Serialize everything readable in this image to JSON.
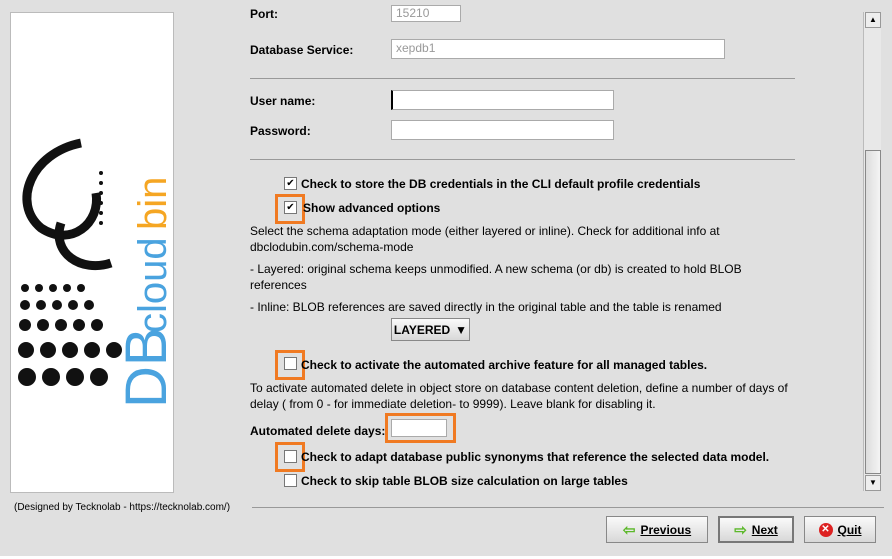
{
  "form": {
    "port_label": "Port:",
    "port_value": "15210",
    "service_label": "Database Service:",
    "service_value": "xepdb1",
    "user_label": "User name:",
    "user_value": "",
    "password_label": "Password:",
    "password_value": "",
    "store_creds_label": "Check to store the DB credentials in the CLI default profile credentials",
    "store_creds_checked": true,
    "advanced_label": "Show advanced options",
    "advanced_checked": true,
    "schema_info_1": "Select the schema adaptation mode (either layered or inline). Check for additional info at",
    "schema_info_2": "dbclodubin.com/schema-mode",
    "layered_info": " - Layered: original schema keeps unmodified. A new schema (or db) is created to hold BLOB references",
    "inline_info": " - Inline: BLOB references are saved directly in the original table and the table is renamed",
    "mode_value": "LAYERED",
    "archive_label": "Check to activate the automated archive feature for all managed tables.",
    "archive_checked": false,
    "delete_info": "To activate automated delete in object store on database content deletion, define a number of days of delay ( from 0 - for immediate deletion- to 9999). Leave blank for disabling it.",
    "delete_days_label": "Automated delete days:",
    "delete_days_value": "",
    "synonyms_label": "Check to adapt database public synonyms that reference the selected data model.",
    "synonyms_checked": false,
    "skip_blob_label": "Check to skip table BLOB size calculation on large tables",
    "skip_blob_checked": false
  },
  "logo": {
    "text_db": "DB",
    "text_cloud": "cloud",
    "text_bin": "bin"
  },
  "footer": {
    "credit": "(Designed by Tecknolab - https://tecknolab.com/)",
    "previous": "Previous",
    "next": "Next",
    "quit": "Quit"
  },
  "colors": {
    "highlight": "#f07a22",
    "logo_blue": "#4aa3df",
    "logo_orange": "#f5a623"
  }
}
